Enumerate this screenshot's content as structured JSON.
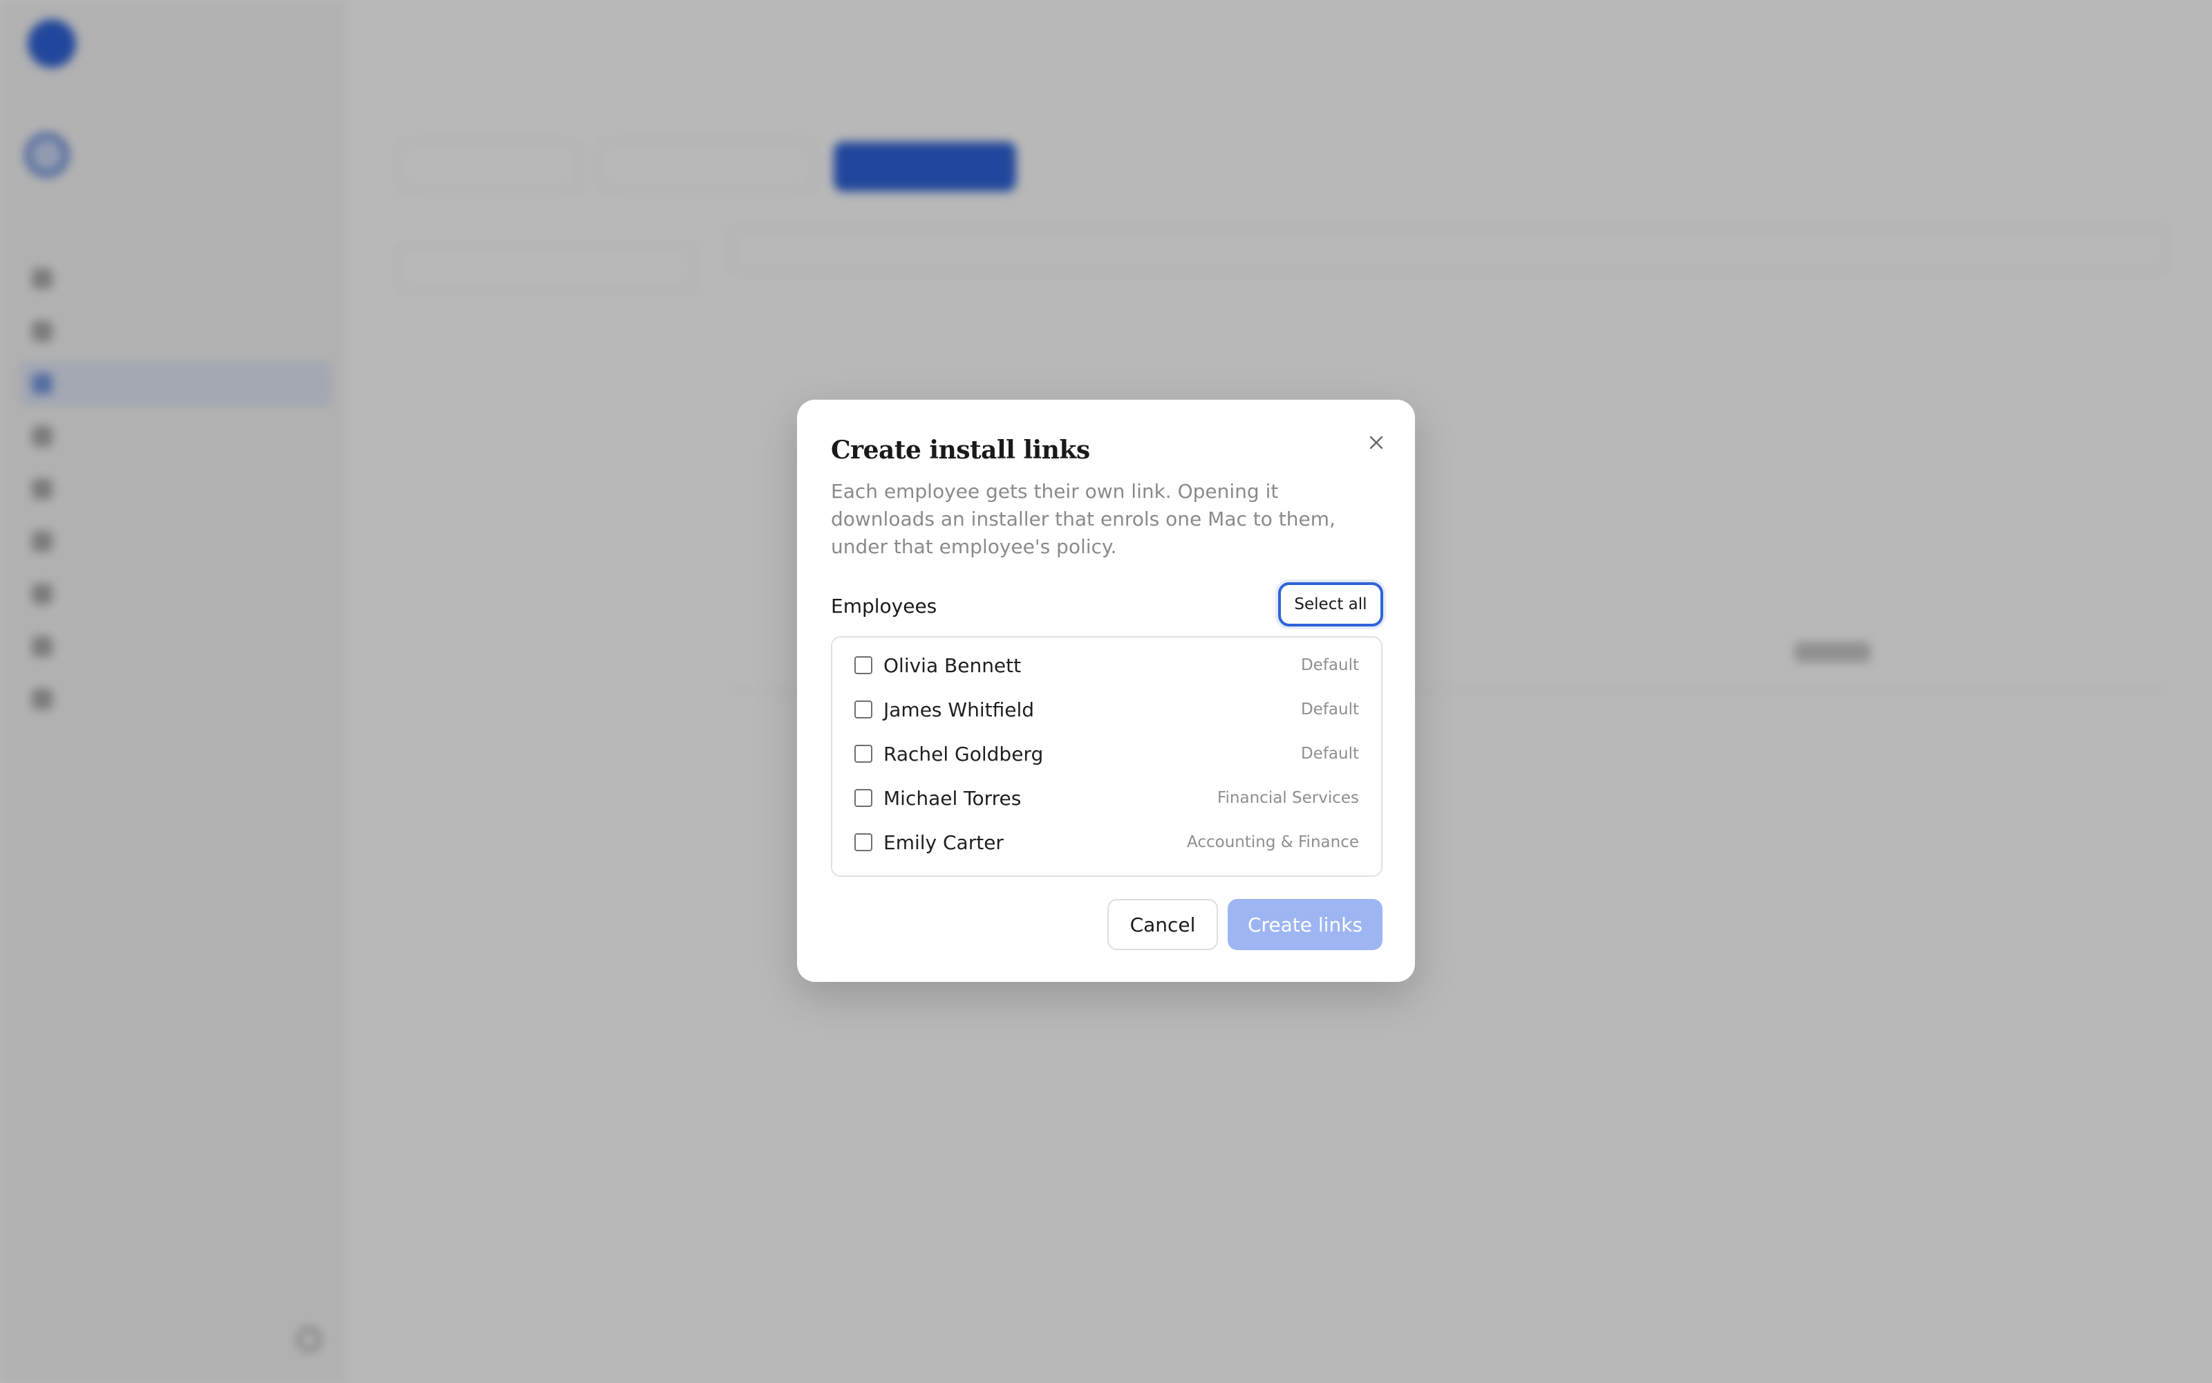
{
  "modal": {
    "title": "Create install links",
    "description": "Each employee gets their own link. Opening it downloads an installer that enrols one Mac to them, under that employee's policy.",
    "section_label": "Employees",
    "select_all_label": "Select all",
    "employees": [
      {
        "name": "Olivia Bennett",
        "policy": "Default",
        "checked": false
      },
      {
        "name": "James Whitfield",
        "policy": "Default",
        "checked": false
      },
      {
        "name": "Rachel Goldberg",
        "policy": "Default",
        "checked": false
      },
      {
        "name": "Michael Torres",
        "policy": "Financial Services",
        "checked": false
      },
      {
        "name": "Emily Carter",
        "policy": "Accounting & Finance",
        "checked": false
      }
    ],
    "cancel_label": "Cancel",
    "create_label": "Create links",
    "close_icon": "close-icon"
  },
  "colors": {
    "accent": "#2f63d8",
    "primary_disabled": "#9db5f2",
    "overlay": "rgba(0,0,0,0.28)"
  }
}
